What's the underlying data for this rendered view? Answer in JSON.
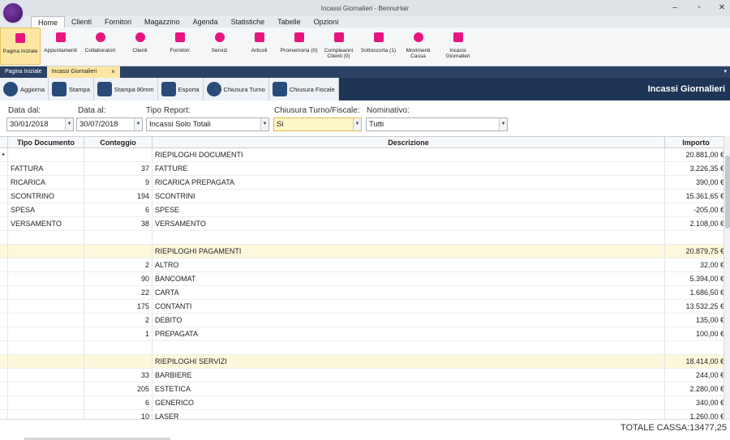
{
  "window": {
    "title": "Incassi Giornalieri - BennuHair"
  },
  "menu": [
    "Home",
    "Clienti",
    "Fornitori",
    "Magazzino",
    "Agenda",
    "Statistiche",
    "Tabelle",
    "Opzioni"
  ],
  "ribbon": [
    {
      "label": "Pagina Iniziale",
      "icon": "shop-icon"
    },
    {
      "label": "Appuntamenti",
      "icon": "calendar-icon"
    },
    {
      "label": "Collaboratori",
      "icon": "staff-icon"
    },
    {
      "label": "Clienti",
      "icon": "client-icon"
    },
    {
      "label": "Fornitori",
      "icon": "supplier-icon"
    },
    {
      "label": "Servizi",
      "icon": "scissors-icon"
    },
    {
      "label": "Articoli",
      "icon": "bottles-icon"
    },
    {
      "label": "Promemoria (0)",
      "icon": "memo-icon"
    },
    {
      "label": "Compleanni Clienti (0)",
      "icon": "cake-icon"
    },
    {
      "label": "Sottoscorta (1)",
      "icon": "megaphone-icon"
    },
    {
      "label": "Movimenti Cassa",
      "icon": "coins-icon"
    },
    {
      "label": "Incassi Giornalieri",
      "icon": "chart-icon"
    }
  ],
  "doctabs": [
    {
      "label": "Pagina Iniziale"
    },
    {
      "label": "Incassi Giornalieri",
      "close": "×"
    }
  ],
  "doctab_dropdown": "▾",
  "toolbar": {
    "buttons": [
      {
        "label": "Aggiorna",
        "icon": "refresh-icon"
      },
      {
        "label": "Stampa",
        "icon": "printer-icon"
      },
      {
        "label": "Stampa 80mm",
        "icon": "printer-icon"
      },
      {
        "label": "Esporta",
        "icon": "export-icon"
      },
      {
        "label": "Chiusura Turno",
        "icon": "users-icon"
      },
      {
        "label": "Chiusura Fiscale",
        "icon": "receipt-icon"
      }
    ],
    "title": "Incassi Giornalieri"
  },
  "filters": {
    "data_dal": {
      "label": "Data dal:",
      "value": "30/01/2018"
    },
    "data_al": {
      "label": "Data al:",
      "value": "30/07/2018"
    },
    "tipo_report": {
      "label": "Tipo Report:",
      "value": "Incassi Solo Totali"
    },
    "chiusura": {
      "label": "Chiusura Turno/Fiscale:",
      "value": "Si"
    },
    "nominativo": {
      "label": "Nominativo:",
      "value": "Tutti"
    }
  },
  "grid": {
    "columns": [
      "Tipo Documento",
      "Conteggio",
      "Descrizione",
      "Importo"
    ],
    "rows": [
      {
        "marker": "▸",
        "tipo": "",
        "conteggio": "",
        "descrizione": "RIEPILOGHI DOCUMENTI",
        "importo": "20.881,00 €",
        "hl": false
      },
      {
        "tipo": "FATTURA",
        "conteggio": "37",
        "descrizione": "FATTURE",
        "importo": "3.226,35 €"
      },
      {
        "tipo": "RICARICA",
        "conteggio": "9",
        "descrizione": "RICARICA PREPAGATA",
        "importo": "390,00 €"
      },
      {
        "tipo": "SCONTRINO",
        "conteggio": "194",
        "descrizione": "SCONTRINI",
        "importo": "15.361,65 €"
      },
      {
        "tipo": "SPESA",
        "conteggio": "6",
        "descrizione": "SPESE",
        "importo": "-205,00 €"
      },
      {
        "tipo": "VERSAMENTO",
        "conteggio": "38",
        "descrizione": "VERSAMENTO",
        "importo": "2.108,00 €"
      },
      {
        "tipo": "",
        "conteggio": "",
        "descrizione": "",
        "importo": ""
      },
      {
        "tipo": "",
        "conteggio": "",
        "descrizione": "RIEPILOGHI PAGAMENTI",
        "importo": "20.879,75 €",
        "hl": true
      },
      {
        "tipo": "",
        "conteggio": "2",
        "descrizione": "ALTRO",
        "importo": "32,00 €"
      },
      {
        "tipo": "",
        "conteggio": "90",
        "descrizione": "BANCOMAT",
        "importo": "5.394,00 €"
      },
      {
        "tipo": "",
        "conteggio": "22",
        "descrizione": "CARTA",
        "importo": "1.686,50 €"
      },
      {
        "tipo": "",
        "conteggio": "175",
        "descrizione": "CONTANTI",
        "importo": "13.532,25 €"
      },
      {
        "tipo": "",
        "conteggio": "2",
        "descrizione": "DEBITO",
        "importo": "135,00 €"
      },
      {
        "tipo": "",
        "conteggio": "1",
        "descrizione": "PREPAGATA",
        "importo": "100,00 €"
      },
      {
        "tipo": "",
        "conteggio": "",
        "descrizione": "",
        "importo": ""
      },
      {
        "tipo": "",
        "conteggio": "",
        "descrizione": "RIEPILOGHI SERVIZI",
        "importo": "18.414,00 €",
        "hl": true
      },
      {
        "tipo": "",
        "conteggio": "33",
        "descrizione": "BARBIERE",
        "importo": "244,00 €"
      },
      {
        "tipo": "",
        "conteggio": "205",
        "descrizione": "ESTETICA",
        "importo": "2.280,00 €"
      },
      {
        "tipo": "",
        "conteggio": "6",
        "descrizione": "GENERICO",
        "importo": "340,00 €"
      },
      {
        "tipo": "",
        "conteggio": "10",
        "descrizione": "LASER",
        "importo": "1.260,00 €"
      }
    ]
  },
  "footer": {
    "total": "TOTALE CASSA:13477,25"
  },
  "colors": {
    "accent": "#e9157e",
    "navy": "#1f3558",
    "highlight": "#fbe6a2"
  }
}
